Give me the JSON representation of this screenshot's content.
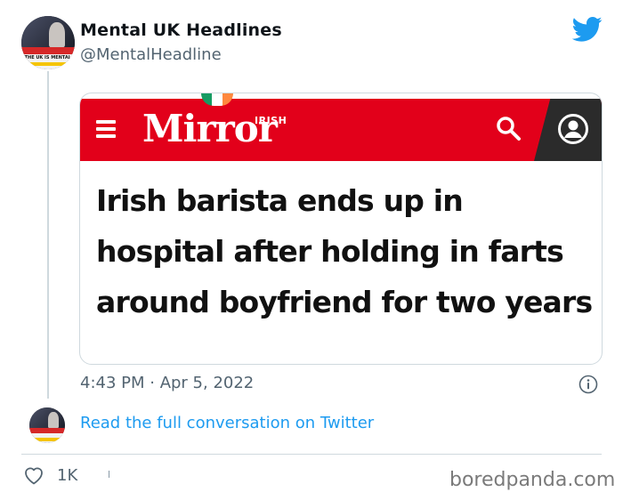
{
  "tweet": {
    "display_name": "Mental UK Headlines",
    "handle": "@MentalHeadline",
    "timestamp": "4:43 PM · Apr 5, 2022",
    "avatar_caption": "THE UK IS MENTAL",
    "read_link": "Read the full conversation on Twitter",
    "likes": "1K"
  },
  "embed": {
    "brand_small": "IRISH",
    "brand": "Mirror",
    "headline": "Irish barista ends up in hospital after holding in farts around boyfriend for two years",
    "brand_color": "#e2001a"
  },
  "watermark": "boredpanda.com",
  "icons": [
    "twitter-bird-icon",
    "menu-icon",
    "search-icon",
    "user-icon",
    "info-icon",
    "heart-icon"
  ],
  "colors": {
    "link": "#1d9bf0",
    "twitter_blue": "#1d9bf0",
    "muted": "#536471"
  }
}
